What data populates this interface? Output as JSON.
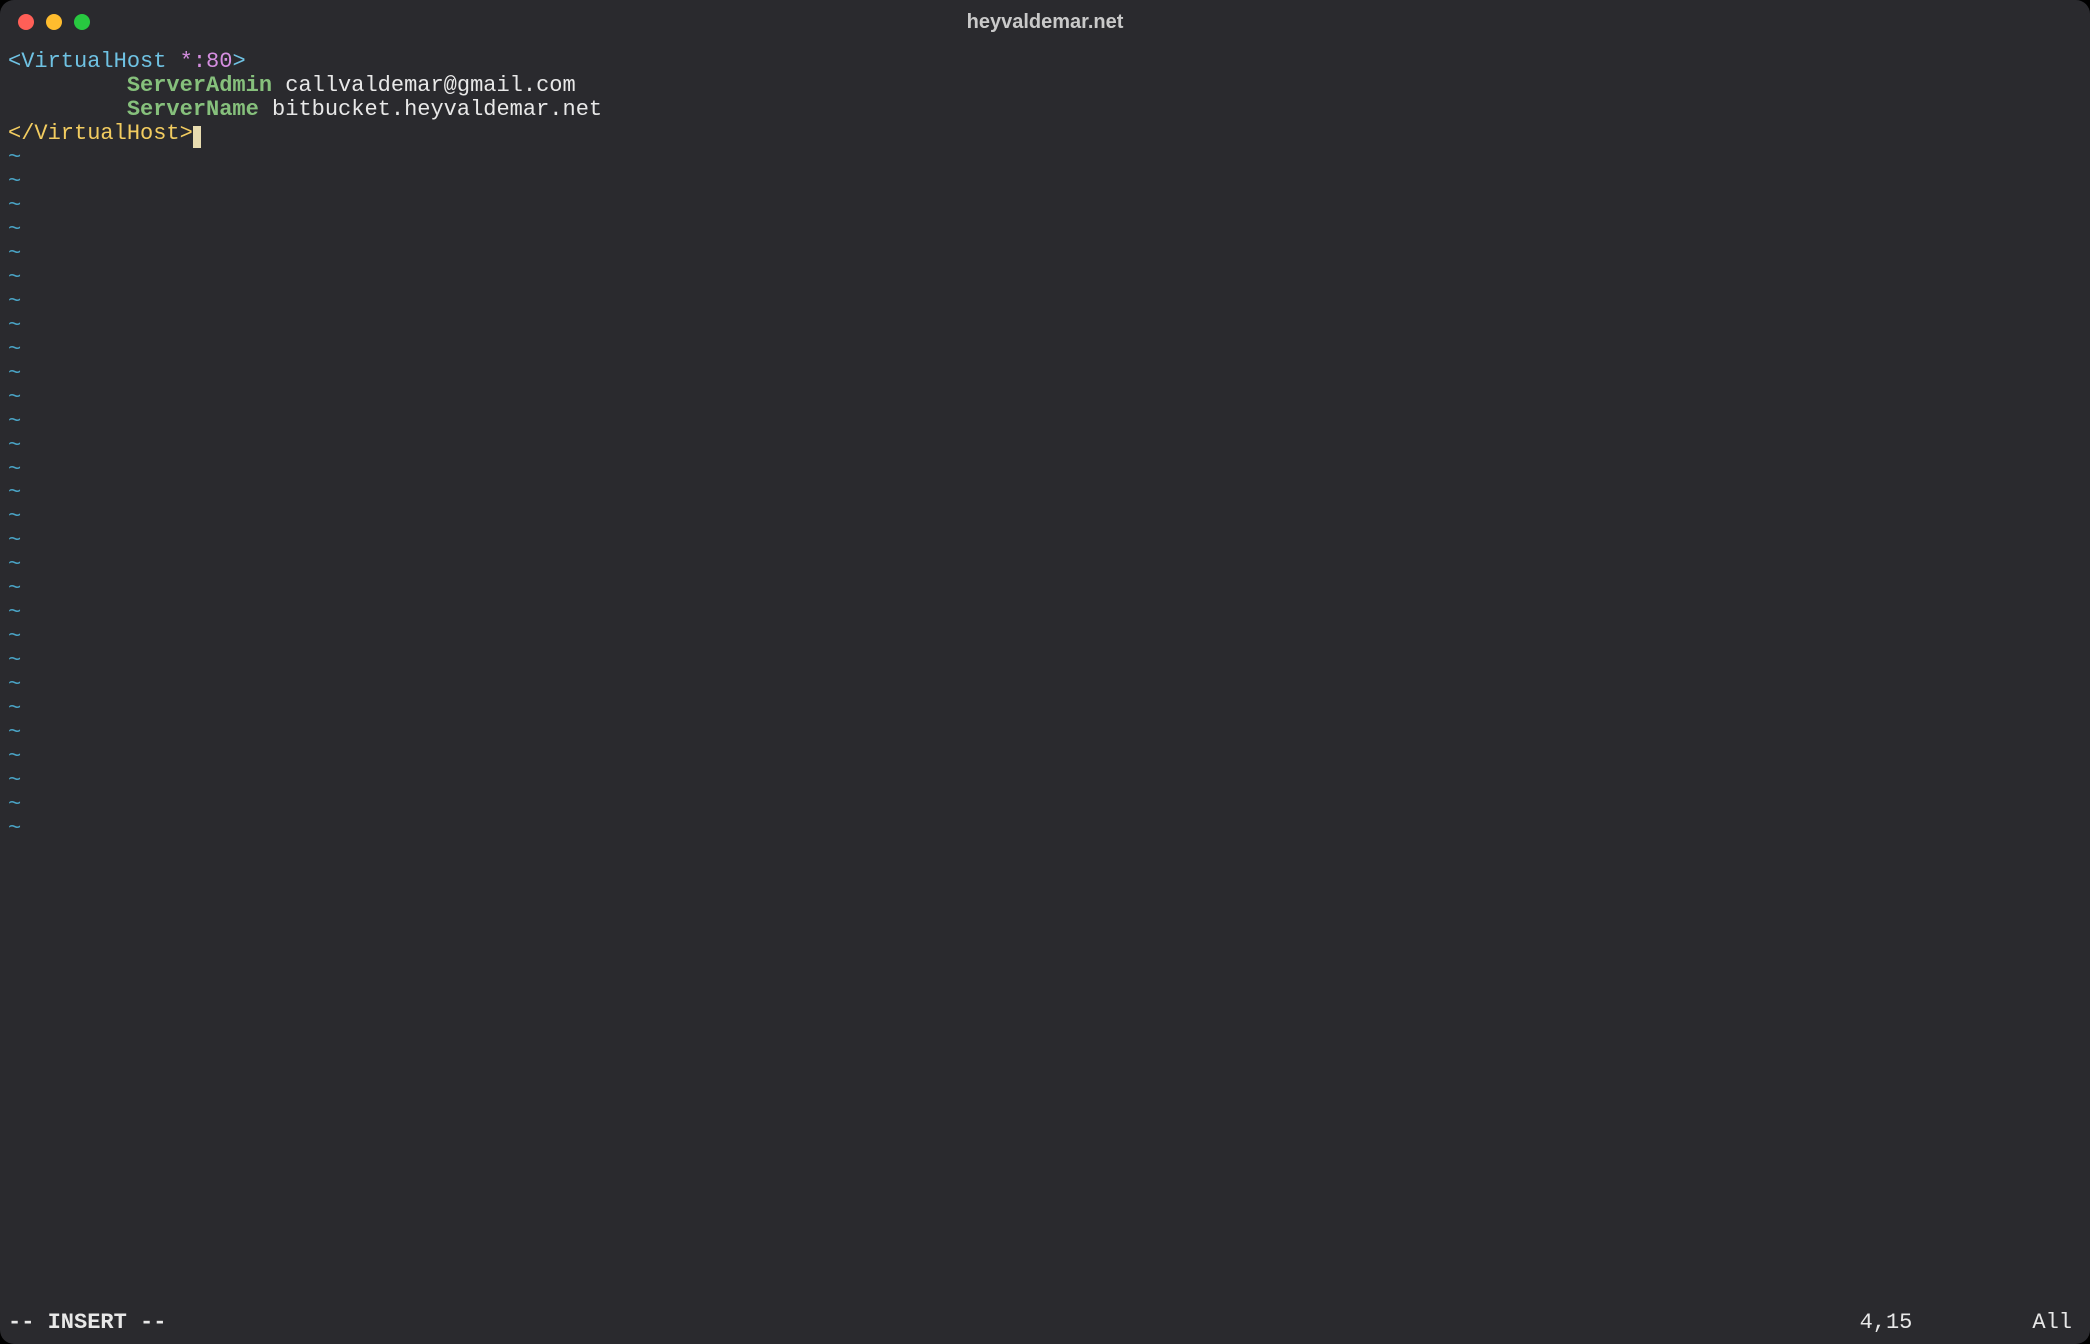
{
  "window": {
    "title": "heyvaldemar.net"
  },
  "editor": {
    "lines": [
      {
        "segments": [
          {
            "text": "<",
            "cls": "c-angle"
          },
          {
            "text": "VirtualHost",
            "cls": "c-tag"
          },
          {
            "text": " ",
            "cls": ""
          },
          {
            "text": "*:80",
            "cls": "c-star"
          },
          {
            "text": ">",
            "cls": "c-angle"
          }
        ]
      },
      {
        "indent": true,
        "segments": [
          {
            "text": "ServerAdmin",
            "cls": "c-kw"
          },
          {
            "text": " callvaldemar@gmail.com",
            "cls": "c-val"
          }
        ]
      },
      {
        "indent": true,
        "segments": [
          {
            "text": "ServerName",
            "cls": "c-kw"
          },
          {
            "text": " bitbucket.heyvaldemar.net",
            "cls": "c-val"
          }
        ]
      },
      {
        "segments": [
          {
            "text": "</VirtualHost>",
            "cls": "c-close"
          }
        ],
        "cursor_after": true
      }
    ],
    "tilde_marker": "~",
    "tilde_count": 29
  },
  "status": {
    "mode": "-- INSERT --",
    "position": "4,15",
    "scroll": "All"
  }
}
